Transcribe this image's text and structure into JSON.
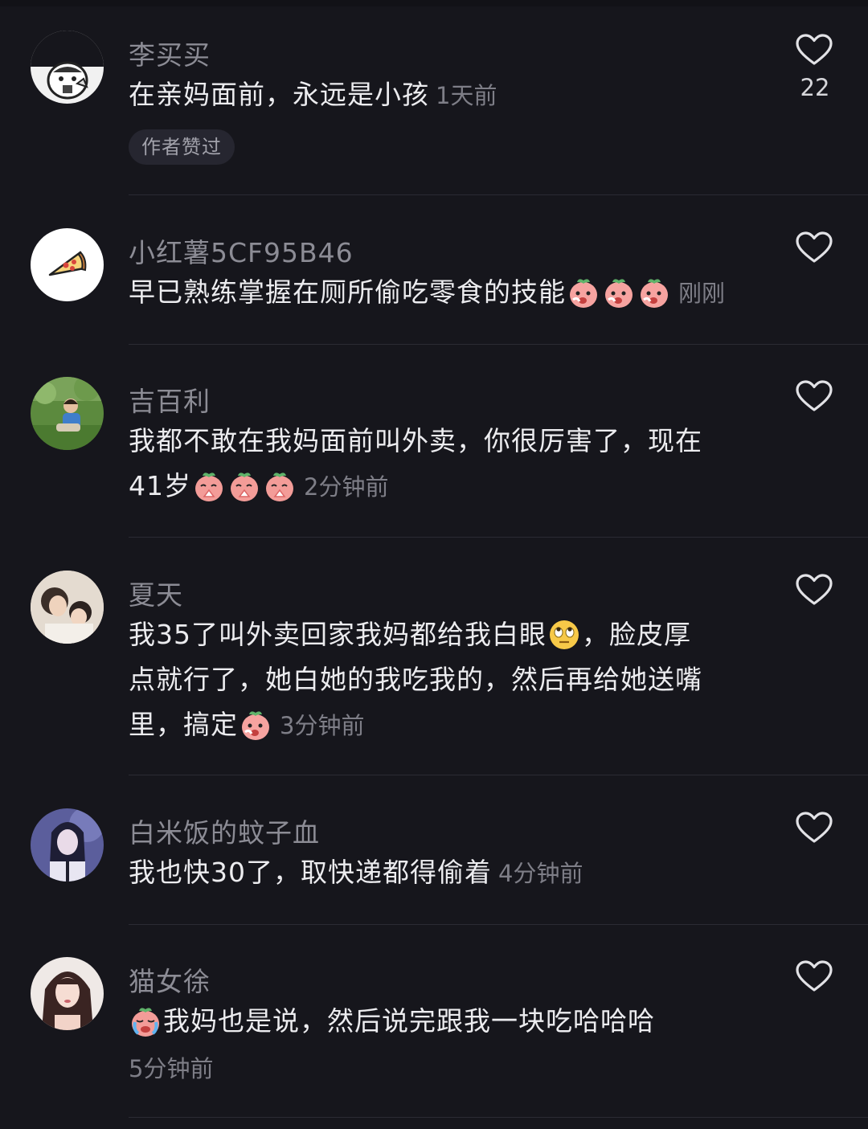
{
  "comments": [
    {
      "username": "李买买",
      "text": "在亲妈面前，永远是小孩",
      "time": "1天前",
      "like_count": "22",
      "badge": "作者赞过",
      "avatar_icon": "cartoon-avatar"
    },
    {
      "username": "小红薯5CF95B46",
      "text": "早已熟练掌握在厕所偷吃零食的技能",
      "emoji": [
        "eating-peach-emoji",
        "eating-peach-emoji",
        "eating-peach-emoji"
      ],
      "time": "刚刚",
      "avatar_icon": "pizza-avatar"
    },
    {
      "username": "吉百利",
      "text_line1": "我都不敢在我妈面前叫外卖，你很厉害了，现在",
      "text_line2": "41岁",
      "emoji": [
        "praying-peach-emoji",
        "praying-peach-emoji",
        "praying-peach-emoji"
      ],
      "time": "2分钟前",
      "avatar_icon": "child-photo-avatar"
    },
    {
      "username": "夏天",
      "text_line1a": "我35了叫外卖回家我妈都给我白眼",
      "text_line1b": "，脸皮厚",
      "text_line2": "点就行了，她白她的我吃我的，然后再给她送嘴",
      "text_line3": "里，搞定",
      "emoji": [
        "eye-roll-emoji",
        "eating-peach-emoji"
      ],
      "time": "3分钟前",
      "avatar_icon": "family-photo-avatar"
    },
    {
      "username": "白米饭的蚊子血",
      "text": "我也快30了，取快递都得偷着",
      "time": "4分钟前",
      "avatar_icon": "girl-photo-avatar"
    },
    {
      "username": "猫女徐",
      "text": "我妈也是说，然后说完跟我一块吃哈哈哈",
      "emoji": [
        "crying-peach-emoji"
      ],
      "time": "5分钟前",
      "avatar_icon": "woman-photo-avatar"
    }
  ],
  "colors": {
    "background": "#16161c",
    "username": "#8c8c95",
    "text": "#ececef",
    "time": "#7e7e87",
    "divider": "#2b2b33"
  }
}
